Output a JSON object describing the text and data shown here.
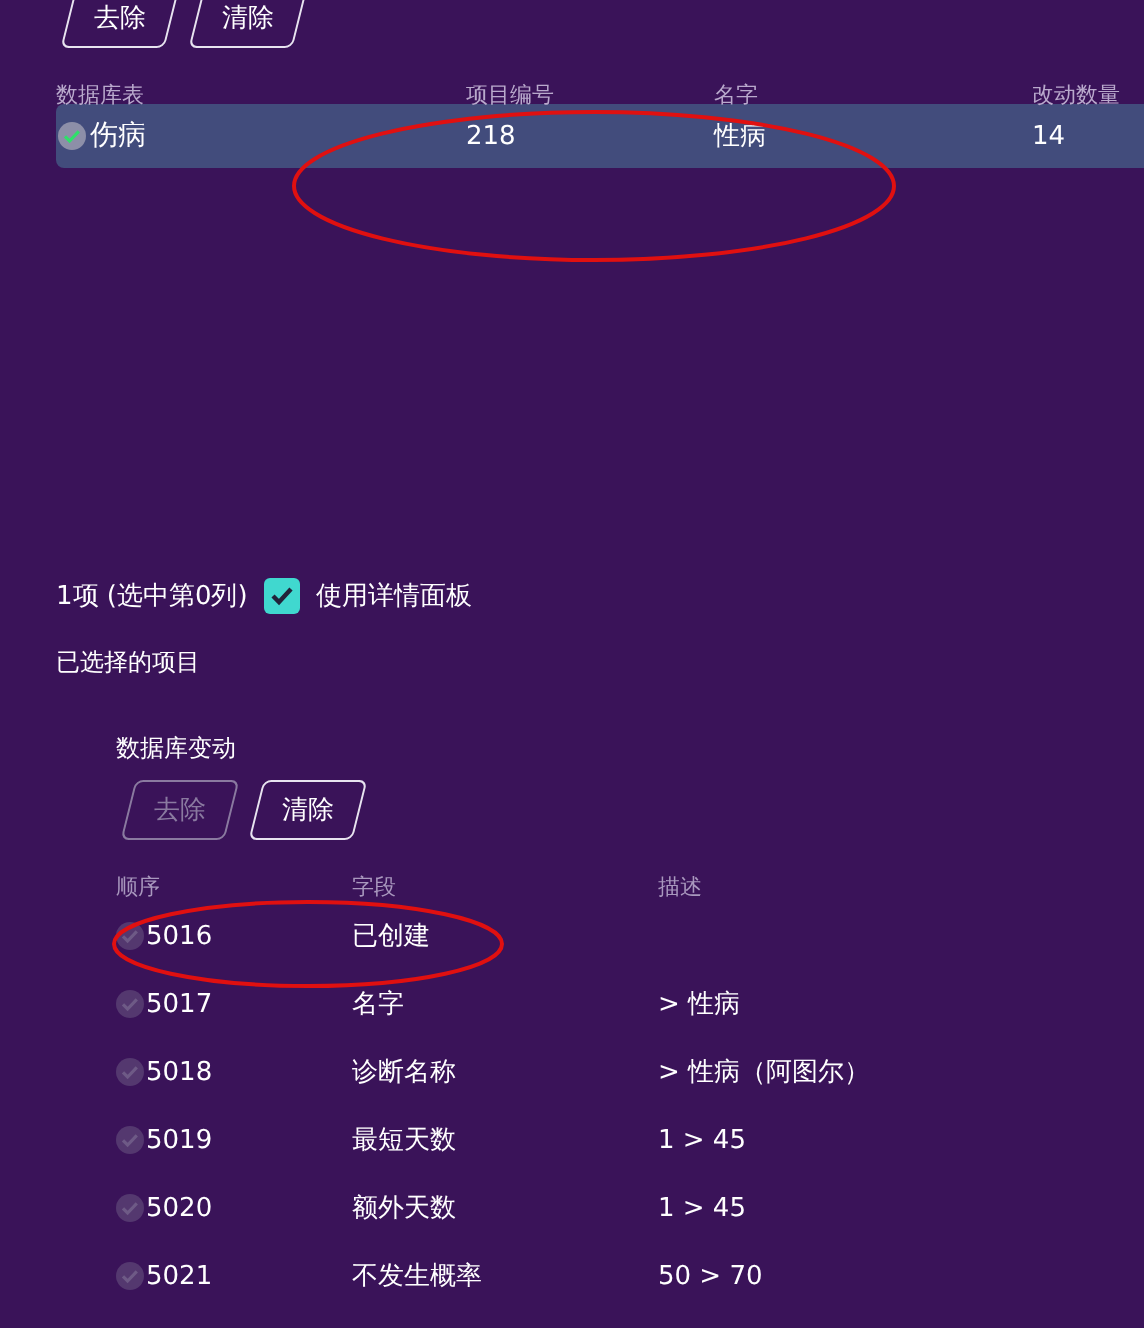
{
  "top_buttons": [
    {
      "label": "去除",
      "disabled": false
    },
    {
      "label": "清除",
      "disabled": false
    }
  ],
  "table": {
    "columns": [
      "数据库表",
      "项目编号",
      "名字",
      "改动数量"
    ],
    "rows": [
      {
        "cells": [
          "伤病",
          "218",
          "性病",
          "14"
        ],
        "checked": true,
        "selected": true
      }
    ]
  },
  "selection_summary": "1项 (选中第0列)",
  "use_detail_panel": {
    "label": "使用详情面板",
    "checked": true
  },
  "selected_items_title": "已选择的项目",
  "changes": {
    "title": "数据库变动",
    "buttons": [
      {
        "label": "去除",
        "disabled": true
      },
      {
        "label": "清除",
        "disabled": false
      }
    ],
    "columns": [
      "顺序",
      "字段",
      "描述"
    ],
    "rows": [
      {
        "order": "5016",
        "field": "已创建",
        "checked": false
      },
      {
        "order": "5017",
        "field": "名字",
        "description": "> 性病",
        "checked": false
      },
      {
        "order": "5018",
        "field": "诊断名称",
        "description": "> 性病（阿图尔）",
        "checked": false
      },
      {
        "order": "5019",
        "field": "最短天数",
        "description": "1 > 45",
        "checked": false
      },
      {
        "order": "5020",
        "field": "额外天数",
        "description": "1 > 45",
        "checked": false
      },
      {
        "order": "5021",
        "field": "不发生概率",
        "description": "50 > 70",
        "checked": false
      }
    ]
  }
}
